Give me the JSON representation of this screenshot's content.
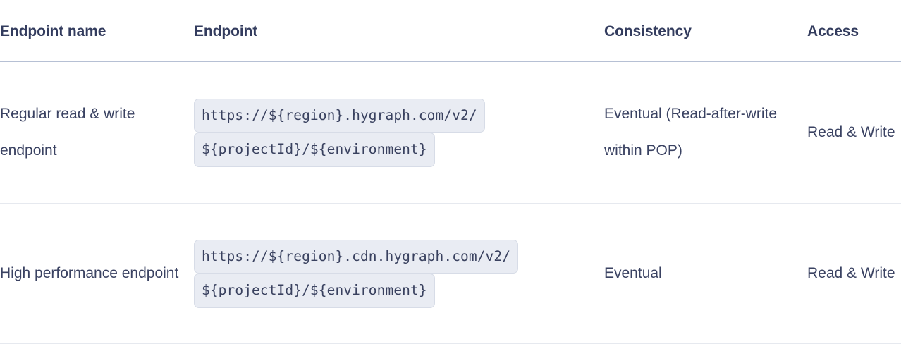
{
  "table": {
    "columns": [
      {
        "key": "endpoint_name",
        "label": "Endpoint name"
      },
      {
        "key": "endpoint",
        "label": "Endpoint"
      },
      {
        "key": "consistency",
        "label": "Consistency"
      },
      {
        "key": "access",
        "label": "Access"
      }
    ],
    "rows": [
      {
        "endpoint_name": "Regular read & write endpoint",
        "endpoint_code": [
          "https://${region}.hygraph.com/v2/",
          "${projectId}/${environment}"
        ],
        "consistency": "Eventual (Read-after-write within POP)",
        "access": "Read & Write"
      },
      {
        "endpoint_name": "High performance endpoint",
        "endpoint_code": [
          "https://${region}.cdn.hygraph.com/v2/",
          "${projectId}/${environment}"
        ],
        "consistency": "Eventual",
        "access": "Read & Write"
      }
    ]
  },
  "colors": {
    "text": "#333c5e",
    "body_text": "#3a4262",
    "header_rule": "#b6c0d4",
    "row_rule": "#e6e9ef",
    "code_bg": "#e9ecf3",
    "code_border": "#d7dce7",
    "code_text": "#39415f",
    "page_bg": "#ffffff"
  }
}
